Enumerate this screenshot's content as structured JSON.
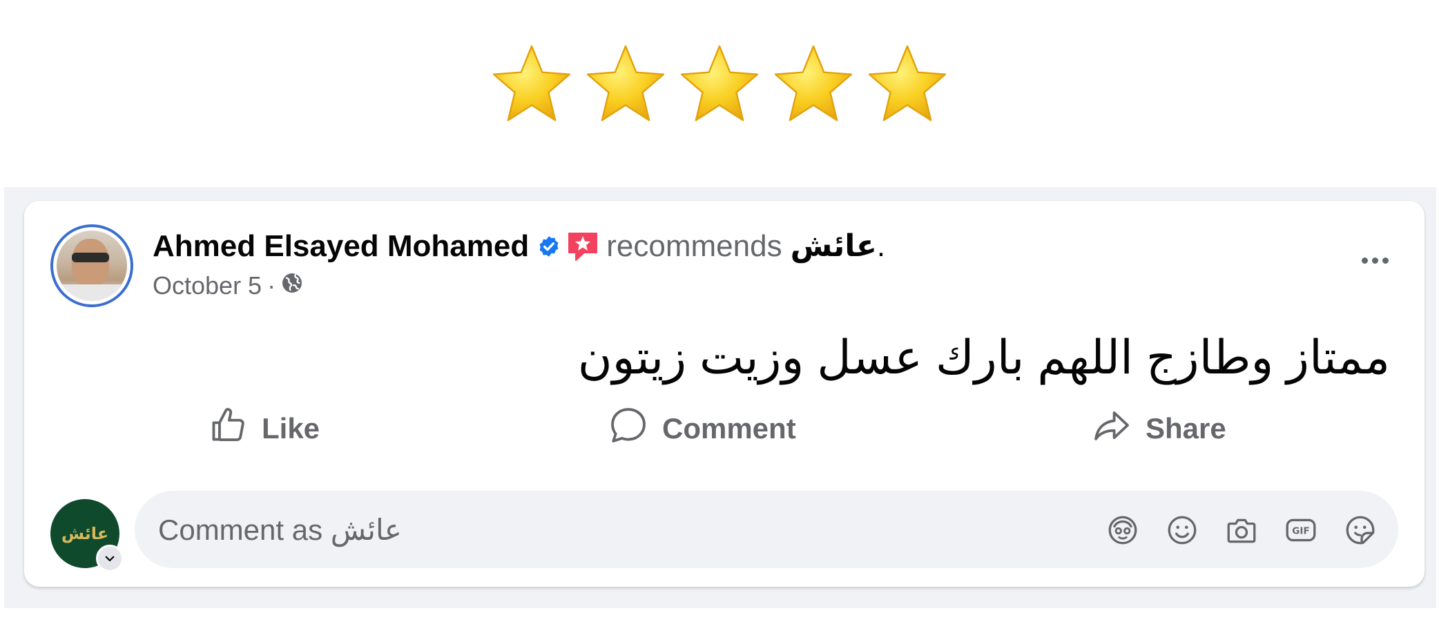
{
  "rating": {
    "value": 5,
    "max": 5,
    "star_color": "#f7c624"
  },
  "post": {
    "author": "Ahmed Elsayed Mohamed",
    "verified_icon": "verified-badge-icon",
    "recommends_text": "recommends",
    "page_name": "عائش",
    "period": ".",
    "date": "October 5",
    "separator": "·",
    "audience_icon": "globe-icon",
    "body_text": "ممتاز وطازج اللهم بارك عسل وزيت زيتون",
    "more_icon": "more-options-icon"
  },
  "actions": {
    "like_label": "Like",
    "comment_label": "Comment",
    "share_label": "Share"
  },
  "comment": {
    "placeholder": "Comment as عائش",
    "commenter_logo_text": "عائش",
    "icons": [
      "avatar-sticker-icon",
      "emoji-icon",
      "camera-icon",
      "gif-icon",
      "sticker-icon"
    ]
  },
  "colors": {
    "verified_blue": "#1877f2",
    "recommend_red": "#f3425f",
    "secondary_text": "#65676b",
    "page_background": "#f0f2f5",
    "commenter_bg": "#0e4a2b"
  }
}
